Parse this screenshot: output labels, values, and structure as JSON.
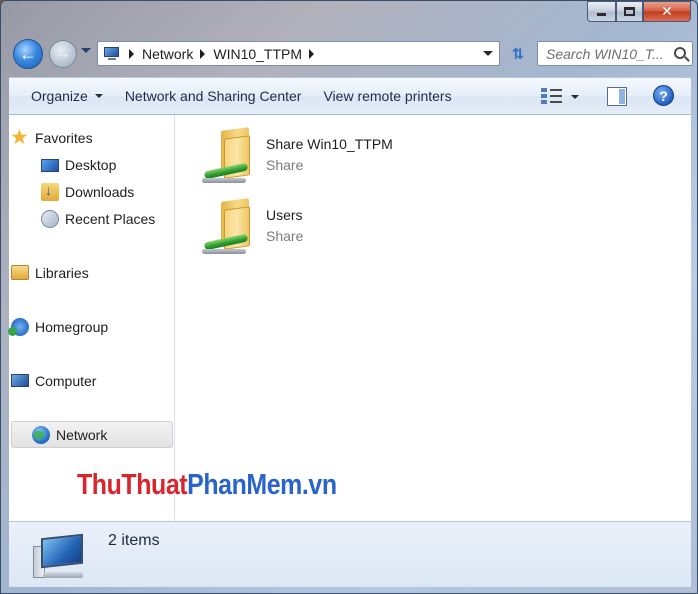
{
  "window": {
    "caption_buttons": [
      "minimize",
      "maximize",
      "close"
    ]
  },
  "navigation": {
    "breadcrumbs": [
      "Network",
      "WIN10_TTPM"
    ],
    "search_placeholder": "Search WIN10_T..."
  },
  "toolbar": {
    "organize_label": "Organize",
    "network_sharing_label": "Network and Sharing Center",
    "remote_printers_label": "View remote printers",
    "help_label": "?"
  },
  "sidebar": {
    "favorites": "Favorites",
    "desktop": "Desktop",
    "downloads": "Downloads",
    "recent_places": "Recent Places",
    "libraries": "Libraries",
    "homegroup": "Homegroup",
    "computer": "Computer",
    "network": "Network",
    "selected": "Network"
  },
  "items": [
    {
      "name": "Share Win10_TTPM",
      "type": "Share"
    },
    {
      "name": "Users",
      "type": "Share"
    }
  ],
  "watermark": {
    "part1": "ThuThuat",
    "part2": "PhanMem.vn",
    "color1": "#d7262e",
    "color2": "#2a63c9"
  },
  "status": {
    "item_count": "2 items"
  }
}
